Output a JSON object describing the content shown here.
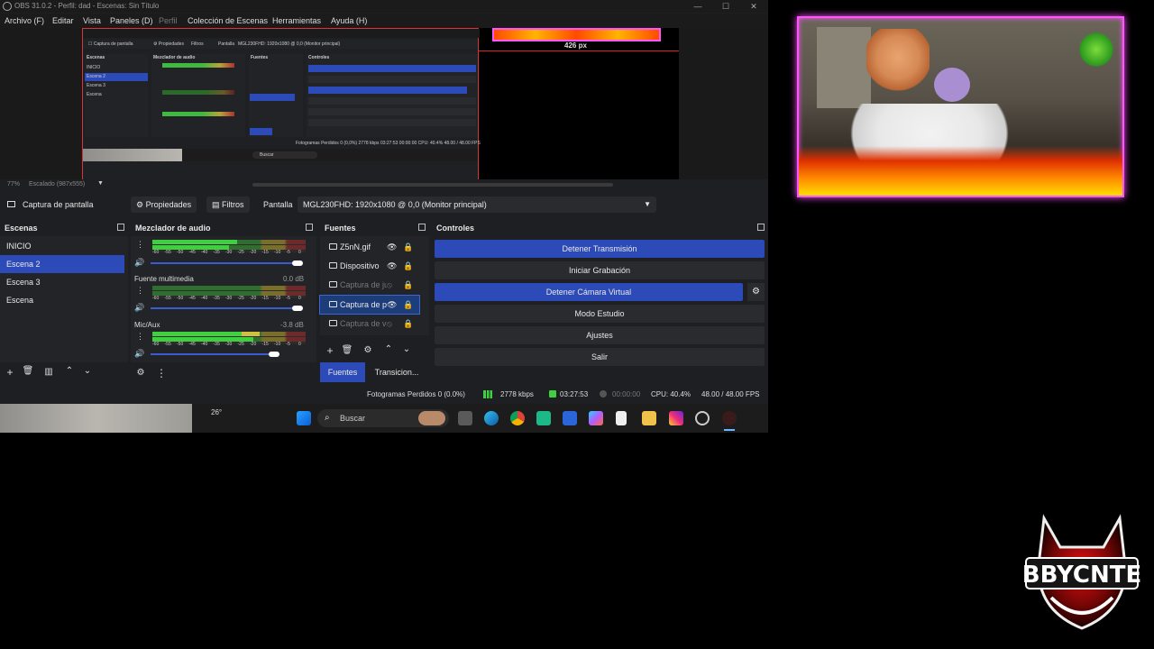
{
  "window": {
    "title": "OBS 31.0.2 - Perfil: dad - Escenas: Sin Título",
    "min": "—",
    "max": "☐",
    "close": "✕"
  },
  "menu": [
    "Archivo (F)",
    "Editar",
    "Vista",
    "Paneles (D)",
    "Perfil",
    "Colección de Escenas",
    "Herramientas",
    "Ayuda (H)"
  ],
  "preview": {
    "dim_label": "426 px",
    "zoom": "77%",
    "scale_label": "Escalado (987x555)",
    "scale_chevron": "▼"
  },
  "nested": {
    "fps_line": "Fotogramas Perdidos 0 (0,0%)   2778 kbps   03:27:53   00:00:00   CPU: 40.4%   48.00 / 48.00 FPS",
    "search": "Buscar"
  },
  "source_toolbar": {
    "source_label": "Captura de pantalla",
    "properties": "Propiedades",
    "filters": "Filtros",
    "display_label": "Pantalla",
    "display_value": "MGL230FHD: 1920x1080 @ 0,0 (Monitor principal)"
  },
  "scenes": {
    "title": "Escenas",
    "items": [
      "INICIO",
      "Escena 2",
      "Escena 3",
      "Escena"
    ],
    "selected": 1
  },
  "mixer": {
    "title": "Mezclador de audio",
    "ticks": [
      "-60",
      "-55",
      "-50",
      "-45",
      "-40",
      "-35",
      "-30",
      "-25",
      "-20",
      "-15",
      "-10",
      "-5",
      "0"
    ],
    "channels": [
      {
        "name": "",
        "db": "",
        "level": 0.55
      },
      {
        "name": "Fuente multimedia",
        "db": "0.0 dB",
        "level": 0.0
      },
      {
        "name": "Mic/Aux",
        "db": "-3.8 dB",
        "level": 0.7
      }
    ]
  },
  "sources": {
    "title": "Fuentes",
    "items": [
      {
        "name": "Z5nN.gif",
        "eye": "👁",
        "lock": "🔒"
      },
      {
        "name": "Dispositivo",
        "eye": "👁",
        "lock": "🔒"
      },
      {
        "name": "Captura de ju",
        "eye": "⦸",
        "lock": "🔒"
      },
      {
        "name": "Captura de p",
        "eye": "👁",
        "lock": "🔒"
      },
      {
        "name": "Captura de ve",
        "eye": "⦸",
        "lock": "🔒"
      }
    ],
    "selected": 3,
    "tab_sources": "Fuentes",
    "tab_transitions": "Transicion..."
  },
  "controls": {
    "title": "Controles",
    "buttons": [
      "Detener Transmisión",
      "Iniciar Grabación",
      "Detener Cámara Virtual",
      "Modo Estudio",
      "Ajustes",
      "Salir"
    ]
  },
  "status": {
    "dropped": "Fotogramas Perdidos 0 (0.0%)",
    "kbps": "2778 kbps",
    "stream_time": "03:27:53",
    "rec_time": "00:00:00",
    "cpu": "CPU: 40.4%",
    "fps": "48.00 / 48.00 FPS"
  },
  "taskbar": {
    "weather": "26°",
    "search": "Buscar"
  },
  "colors": {
    "accent": "#2c4bb8",
    "webcam_border": "#ff55ff",
    "preview_border": "#dd2222"
  }
}
